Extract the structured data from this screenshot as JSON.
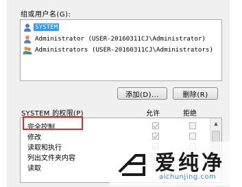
{
  "groups_label": "组或用户名(G):",
  "users": [
    {
      "name": "SYSTEM",
      "icon": "user-icon",
      "selected": true
    },
    {
      "name": "Administrator (USER-20160311CJ\\Administrator)",
      "icon": "user-icon",
      "selected": false
    },
    {
      "name": "Administrators (USER-20160311CJ\\Administrators)",
      "icon": "group-icon",
      "selected": false
    }
  ],
  "buttons": {
    "add": "添加(D)...",
    "remove": "删除(R)"
  },
  "permissions": {
    "title": "SYSTEM 的权限(P)",
    "allow_label": "允许",
    "deny_label": "拒绝",
    "rows": [
      {
        "label": "完全控制",
        "allow": true,
        "deny": false
      },
      {
        "label": "修改",
        "allow": true,
        "deny": false
      },
      {
        "label": "读取和执行",
        "allow": true,
        "deny": false
      },
      {
        "label": "列出文件夹内容",
        "allow": true,
        "deny": false
      },
      {
        "label": "读取",
        "allow": true,
        "deny": false
      }
    ]
  },
  "highlight_color": "#e0292f",
  "selection_color": "#3399ff",
  "watermark": {
    "text": "爱纯净",
    "url": "aichunjing.com"
  }
}
